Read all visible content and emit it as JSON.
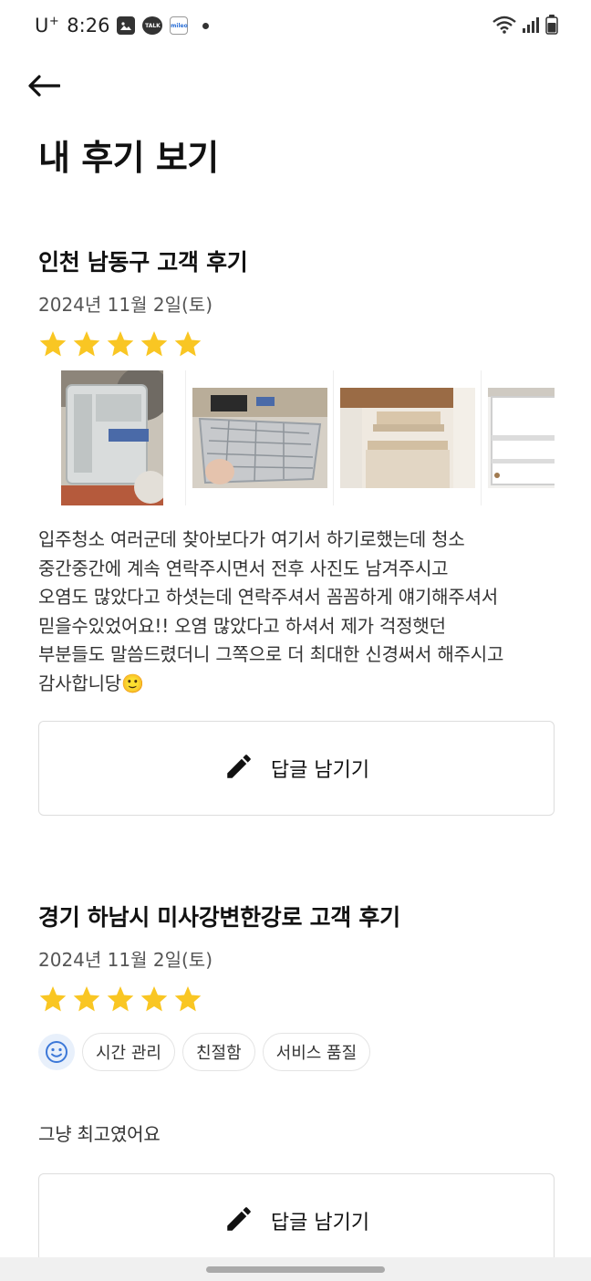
{
  "status_bar": {
    "carrier": "U",
    "carrier_sup": "+",
    "time": "8:26",
    "icons": [
      "gallery-icon",
      "talk-icon",
      "mileo-icon",
      "notification-dot-icon",
      "wifi-icon",
      "signal-icon",
      "battery-icon"
    ],
    "talk_label": "TALK",
    "mileo_label": "mileo"
  },
  "header": {
    "back_icon": "arrow-left-icon",
    "title": "내 후기 보기"
  },
  "reviews": [
    {
      "title": "인천 남동구 고객 후기",
      "date": "2024년 11월 2일(토)",
      "rating": 5,
      "photos": [
        "drawer-tray-photo",
        "wire-basket-photo",
        "cabinet-shelf-photo",
        "white-cabinet-photo"
      ],
      "text": "입주청소 여러군데 찾아보다가 여기서 하기로했는데 청소\n중간중간에 계속 연락주시면서 전후 사진도 남겨주시고\n오염도 많았다고 하셧는데 연락주셔서 꼼꼼하게 얘기해주셔서\n믿을수있었어요!! 오염 많았다고 하셔서 제가 걱정햇던\n부분들도 말씀드렸더니 그쪽으로 더 최대한 신경써서 해주시고\n감사합니당🙂",
      "reply_button": "답글 남기기"
    },
    {
      "title": "경기 하남시 미사강변한강로 고객 후기",
      "date": "2024년 11월 2일(토)",
      "rating": 5,
      "tags": [
        "시간 관리",
        "친절함",
        "서비스 품질"
      ],
      "text": "그냥 최고였어요",
      "reply_button": "답글 남기기"
    }
  ],
  "colors": {
    "star": "#F9C623",
    "tag_emoji_bg": "#E8F0FB",
    "tag_emoji_fg": "#3C78D8",
    "border": "#DDDDDD"
  }
}
